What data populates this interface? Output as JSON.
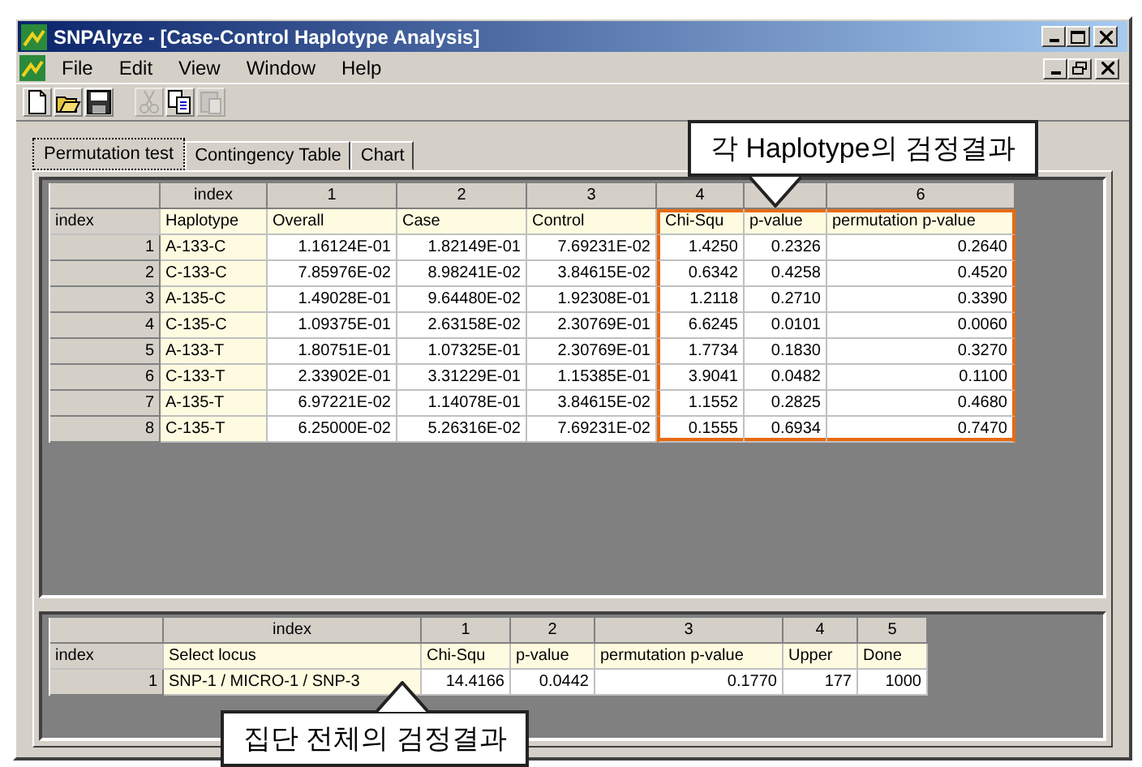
{
  "window": {
    "title": "SNPAlyze - [Case-Control Haplotype Analysis]"
  },
  "menu": [
    "File",
    "Edit",
    "View",
    "Window",
    "Help"
  ],
  "toolbar": [
    {
      "kind": "new",
      "disabled": false
    },
    {
      "kind": "open",
      "disabled": false
    },
    {
      "kind": "save",
      "disabled": false
    },
    {
      "kind": "cut",
      "disabled": true
    },
    {
      "kind": "copy",
      "disabled": false
    },
    {
      "kind": "paste",
      "disabled": true
    }
  ],
  "tabs": [
    {
      "label": "Permutation test",
      "selected": true
    },
    {
      "label": "Contingency Table",
      "selected": false
    },
    {
      "label": "Chart",
      "selected": false
    }
  ],
  "haplotype_table": {
    "corner_label": "index",
    "number_label": "index",
    "columns": [
      {
        "label": "Haplotype",
        "highlighted": false
      },
      {
        "number": "1",
        "label": "Overall",
        "highlighted": false
      },
      {
        "number": "2",
        "label": "Case",
        "highlighted": false
      },
      {
        "number": "3",
        "label": "Control",
        "highlighted": false
      },
      {
        "number": "4",
        "label": "Chi-Squ",
        "highlighted": true
      },
      {
        "label": "p-value",
        "highlighted": true
      },
      {
        "number": "6",
        "label": "permutation p-value",
        "highlighted": true
      }
    ],
    "rows": [
      {
        "index": "1",
        "cells": [
          "A-133-C",
          "1.16124E-01",
          "1.82149E-01",
          "7.69231E-02",
          "1.4250",
          "0.2326",
          "0.2640"
        ]
      },
      {
        "index": "2",
        "cells": [
          "C-133-C",
          "7.85976E-02",
          "8.98241E-02",
          "3.84615E-02",
          "0.6342",
          "0.4258",
          "0.4520"
        ]
      },
      {
        "index": "3",
        "cells": [
          "A-135-C",
          "1.49028E-01",
          "9.64480E-02",
          "1.92308E-01",
          "1.2118",
          "0.2710",
          "0.3390"
        ]
      },
      {
        "index": "4",
        "cells": [
          "C-135-C",
          "1.09375E-01",
          "2.63158E-02",
          "2.30769E-01",
          "6.6245",
          "0.0101",
          "0.0060"
        ]
      },
      {
        "index": "5",
        "cells": [
          "A-133-T",
          "1.80751E-01",
          "1.07325E-01",
          "2.30769E-01",
          "1.7734",
          "0.1830",
          "0.3270"
        ]
      },
      {
        "index": "6",
        "cells": [
          "C-133-T",
          "2.33902E-01",
          "3.31229E-01",
          "1.15385E-01",
          "3.9041",
          "0.0482",
          "0.1100"
        ]
      },
      {
        "index": "7",
        "cells": [
          "A-135-T",
          "6.97221E-02",
          "1.14078E-01",
          "3.84615E-02",
          "1.1552",
          "0.2825",
          "0.4680"
        ]
      },
      {
        "index": "8",
        "cells": [
          "C-135-T",
          "6.25000E-02",
          "5.26316E-02",
          "7.69231E-02",
          "0.1555",
          "0.6934",
          "0.7470"
        ]
      }
    ]
  },
  "summary_table": {
    "corner_label": "index",
    "number_label": "index",
    "columns": [
      {
        "label": "Select locus"
      },
      {
        "number": "1",
        "label": "Chi-Squ"
      },
      {
        "number": "2",
        "label": "p-value"
      },
      {
        "number": "3",
        "label": "permutation p-value"
      },
      {
        "number": "4",
        "label": "Upper"
      },
      {
        "number": "5",
        "label": "Done"
      }
    ],
    "rows": [
      {
        "index": "1",
        "cells": [
          "SNP-1 / MICRO-1 / SNP-3",
          "14.4166",
          "0.0442",
          "0.1770",
          "177",
          "1000"
        ]
      }
    ]
  },
  "callouts": [
    {
      "kind": "down",
      "text": "각 Haplotype의 검정결과"
    },
    {
      "kind": "up",
      "text": "집단 전체의 검정결과"
    }
  ]
}
